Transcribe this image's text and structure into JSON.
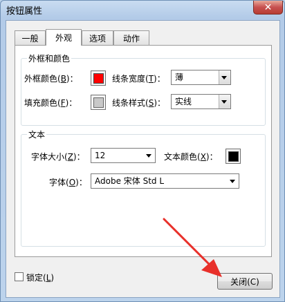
{
  "window": {
    "title": "按钮属性",
    "close_glyph": "✕"
  },
  "tabs": [
    {
      "label": "一般"
    },
    {
      "label": "外观"
    },
    {
      "label": "选项"
    },
    {
      "label": "动作"
    }
  ],
  "border_group": {
    "title": "外框和颜色",
    "border_color_label": "外框颜色(",
    "border_color_key": "B",
    "border_color_suffix": ")：",
    "fill_color_label": "填充颜色(",
    "fill_color_key": "F",
    "fill_color_suffix": ")：",
    "line_width_label": "线条宽度(",
    "line_width_key": "T",
    "line_width_suffix": ")：",
    "line_width_value": "薄",
    "line_style_label": "线条样式(",
    "line_style_key": "S",
    "line_style_suffix": ")：",
    "line_style_value": "实线",
    "border_color_hex": "#ff0000",
    "fill_color_hex": "#c8c8c8"
  },
  "text_group": {
    "title": "文本",
    "font_size_label": "字体大小(",
    "font_size_key": "Z",
    "font_size_suffix": ")：",
    "font_size_value": "12",
    "text_color_label": "文本颜色(",
    "text_color_key": "X",
    "text_color_suffix": ")：",
    "text_color_hex": "#000000",
    "font_label": "字体(",
    "font_key": "O",
    "font_suffix": ")：",
    "font_value": "Adobe 宋体 Std L"
  },
  "footer": {
    "lock_label": "锁定(",
    "lock_key": "L",
    "lock_suffix": ")",
    "ok_label": "关闭(C)"
  },
  "colors": {
    "annotation_arrow": "#e8302a"
  }
}
